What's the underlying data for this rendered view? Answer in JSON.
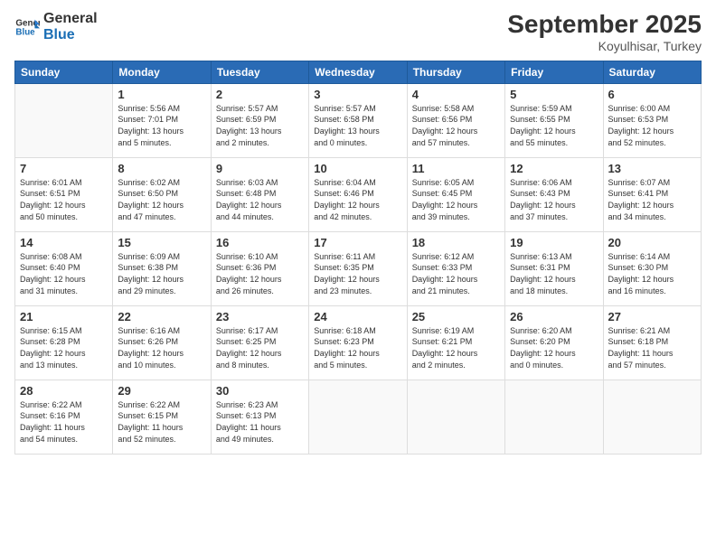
{
  "logo": {
    "line1": "General",
    "line2": "Blue"
  },
  "title": "September 2025",
  "subtitle": "Koyulhisar, Turkey",
  "days_of_week": [
    "Sunday",
    "Monday",
    "Tuesday",
    "Wednesday",
    "Thursday",
    "Friday",
    "Saturday"
  ],
  "weeks": [
    [
      {
        "day": "",
        "info": ""
      },
      {
        "day": "1",
        "info": "Sunrise: 5:56 AM\nSunset: 7:01 PM\nDaylight: 13 hours\nand 5 minutes."
      },
      {
        "day": "2",
        "info": "Sunrise: 5:57 AM\nSunset: 6:59 PM\nDaylight: 13 hours\nand 2 minutes."
      },
      {
        "day": "3",
        "info": "Sunrise: 5:57 AM\nSunset: 6:58 PM\nDaylight: 13 hours\nand 0 minutes."
      },
      {
        "day": "4",
        "info": "Sunrise: 5:58 AM\nSunset: 6:56 PM\nDaylight: 12 hours\nand 57 minutes."
      },
      {
        "day": "5",
        "info": "Sunrise: 5:59 AM\nSunset: 6:55 PM\nDaylight: 12 hours\nand 55 minutes."
      },
      {
        "day": "6",
        "info": "Sunrise: 6:00 AM\nSunset: 6:53 PM\nDaylight: 12 hours\nand 52 minutes."
      }
    ],
    [
      {
        "day": "7",
        "info": "Sunrise: 6:01 AM\nSunset: 6:51 PM\nDaylight: 12 hours\nand 50 minutes."
      },
      {
        "day": "8",
        "info": "Sunrise: 6:02 AM\nSunset: 6:50 PM\nDaylight: 12 hours\nand 47 minutes."
      },
      {
        "day": "9",
        "info": "Sunrise: 6:03 AM\nSunset: 6:48 PM\nDaylight: 12 hours\nand 44 minutes."
      },
      {
        "day": "10",
        "info": "Sunrise: 6:04 AM\nSunset: 6:46 PM\nDaylight: 12 hours\nand 42 minutes."
      },
      {
        "day": "11",
        "info": "Sunrise: 6:05 AM\nSunset: 6:45 PM\nDaylight: 12 hours\nand 39 minutes."
      },
      {
        "day": "12",
        "info": "Sunrise: 6:06 AM\nSunset: 6:43 PM\nDaylight: 12 hours\nand 37 minutes."
      },
      {
        "day": "13",
        "info": "Sunrise: 6:07 AM\nSunset: 6:41 PM\nDaylight: 12 hours\nand 34 minutes."
      }
    ],
    [
      {
        "day": "14",
        "info": "Sunrise: 6:08 AM\nSunset: 6:40 PM\nDaylight: 12 hours\nand 31 minutes."
      },
      {
        "day": "15",
        "info": "Sunrise: 6:09 AM\nSunset: 6:38 PM\nDaylight: 12 hours\nand 29 minutes."
      },
      {
        "day": "16",
        "info": "Sunrise: 6:10 AM\nSunset: 6:36 PM\nDaylight: 12 hours\nand 26 minutes."
      },
      {
        "day": "17",
        "info": "Sunrise: 6:11 AM\nSunset: 6:35 PM\nDaylight: 12 hours\nand 23 minutes."
      },
      {
        "day": "18",
        "info": "Sunrise: 6:12 AM\nSunset: 6:33 PM\nDaylight: 12 hours\nand 21 minutes."
      },
      {
        "day": "19",
        "info": "Sunrise: 6:13 AM\nSunset: 6:31 PM\nDaylight: 12 hours\nand 18 minutes."
      },
      {
        "day": "20",
        "info": "Sunrise: 6:14 AM\nSunset: 6:30 PM\nDaylight: 12 hours\nand 16 minutes."
      }
    ],
    [
      {
        "day": "21",
        "info": "Sunrise: 6:15 AM\nSunset: 6:28 PM\nDaylight: 12 hours\nand 13 minutes."
      },
      {
        "day": "22",
        "info": "Sunrise: 6:16 AM\nSunset: 6:26 PM\nDaylight: 12 hours\nand 10 minutes."
      },
      {
        "day": "23",
        "info": "Sunrise: 6:17 AM\nSunset: 6:25 PM\nDaylight: 12 hours\nand 8 minutes."
      },
      {
        "day": "24",
        "info": "Sunrise: 6:18 AM\nSunset: 6:23 PM\nDaylight: 12 hours\nand 5 minutes."
      },
      {
        "day": "25",
        "info": "Sunrise: 6:19 AM\nSunset: 6:21 PM\nDaylight: 12 hours\nand 2 minutes."
      },
      {
        "day": "26",
        "info": "Sunrise: 6:20 AM\nSunset: 6:20 PM\nDaylight: 12 hours\nand 0 minutes."
      },
      {
        "day": "27",
        "info": "Sunrise: 6:21 AM\nSunset: 6:18 PM\nDaylight: 11 hours\nand 57 minutes."
      }
    ],
    [
      {
        "day": "28",
        "info": "Sunrise: 6:22 AM\nSunset: 6:16 PM\nDaylight: 11 hours\nand 54 minutes."
      },
      {
        "day": "29",
        "info": "Sunrise: 6:22 AM\nSunset: 6:15 PM\nDaylight: 11 hours\nand 52 minutes."
      },
      {
        "day": "30",
        "info": "Sunrise: 6:23 AM\nSunset: 6:13 PM\nDaylight: 11 hours\nand 49 minutes."
      },
      {
        "day": "",
        "info": ""
      },
      {
        "day": "",
        "info": ""
      },
      {
        "day": "",
        "info": ""
      },
      {
        "day": "",
        "info": ""
      }
    ]
  ]
}
